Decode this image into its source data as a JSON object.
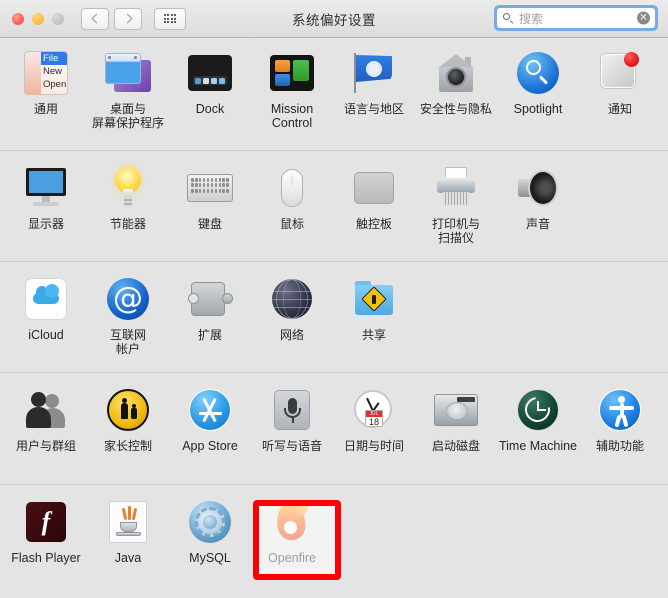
{
  "window": {
    "title": "系统偏好设置",
    "traffic_lights": [
      "close",
      "minimize",
      "zoom"
    ],
    "nav": {
      "back_icon": "chevron-left-icon",
      "forward_icon": "chevron-right-icon",
      "grid_icon": "grid-view-icon"
    },
    "search": {
      "placeholder": "搜索",
      "value": "",
      "icon": "search-icon",
      "clear_icon": "clear-icon",
      "clear_glyph": "✕"
    }
  },
  "highlight": {
    "target": "Openfire",
    "color": "#fb0007"
  },
  "rows": [
    {
      "items": [
        {
          "label": "通用",
          "icon": "general-icon",
          "latin": false,
          "art": {
            "menu_items": [
              "File",
              "New",
              "Open"
            ]
          }
        },
        {
          "label": "桌面与\n屏幕保护程序",
          "icon": "desktop-screensaver-icon",
          "latin": false
        },
        {
          "label": "Dock",
          "icon": "dock-icon",
          "latin": true
        },
        {
          "label": "Mission\nControl",
          "icon": "mission-control-icon",
          "latin": true
        },
        {
          "label": "语言与地区",
          "icon": "language-region-icon",
          "latin": false
        },
        {
          "label": "安全性与隐私",
          "icon": "security-privacy-icon",
          "latin": false
        },
        {
          "label": "Spotlight",
          "icon": "spotlight-icon",
          "latin": true
        },
        {
          "label": "通知",
          "icon": "notifications-icon",
          "latin": false
        }
      ]
    },
    {
      "items": [
        {
          "label": "显示器",
          "icon": "displays-icon",
          "latin": false
        },
        {
          "label": "节能器",
          "icon": "energy-saver-icon",
          "latin": false
        },
        {
          "label": "键盘",
          "icon": "keyboard-icon",
          "latin": false
        },
        {
          "label": "鼠标",
          "icon": "mouse-icon",
          "latin": false
        },
        {
          "label": "触控板",
          "icon": "trackpad-icon",
          "latin": false
        },
        {
          "label": "打印机与\n扫描仪",
          "icon": "printers-scanners-icon",
          "latin": false
        },
        {
          "label": "声音",
          "icon": "sound-icon",
          "latin": false
        }
      ]
    },
    {
      "items": [
        {
          "label": "iCloud",
          "icon": "icloud-icon",
          "latin": true
        },
        {
          "label": "互联网\n帐户",
          "icon": "internet-accounts-icon",
          "latin": false
        },
        {
          "label": "扩展",
          "icon": "extensions-icon",
          "latin": false
        },
        {
          "label": "网络",
          "icon": "network-icon",
          "latin": false
        },
        {
          "label": "共享",
          "icon": "sharing-icon",
          "latin": false
        }
      ]
    },
    {
      "items": [
        {
          "label": "用户与群组",
          "icon": "users-groups-icon",
          "latin": false
        },
        {
          "label": "家长控制",
          "icon": "parental-controls-icon",
          "latin": false
        },
        {
          "label": "App Store",
          "icon": "app-store-icon",
          "latin": true
        },
        {
          "label": "听写与语音",
          "icon": "dictation-speech-icon",
          "latin": false
        },
        {
          "label": "日期与时间",
          "icon": "date-time-icon",
          "latin": false,
          "art": {
            "calendar_month": "JUL",
            "calendar_day": "18"
          }
        },
        {
          "label": "启动磁盘",
          "icon": "startup-disk-icon",
          "latin": false
        },
        {
          "label": "Time Machine",
          "icon": "time-machine-icon",
          "latin": true
        },
        {
          "label": "辅助功能",
          "icon": "accessibility-icon",
          "latin": false
        }
      ]
    },
    {
      "items": [
        {
          "label": "Flash Player",
          "icon": "flash-player-icon",
          "latin": true,
          "art": {
            "glyph": "f"
          }
        },
        {
          "label": "Java",
          "icon": "java-icon",
          "latin": true
        },
        {
          "label": "MySQL",
          "icon": "mysql-icon",
          "latin": true
        },
        {
          "label": "Openfire",
          "icon": "openfire-icon",
          "latin": true,
          "highlighted": true
        }
      ]
    }
  ]
}
